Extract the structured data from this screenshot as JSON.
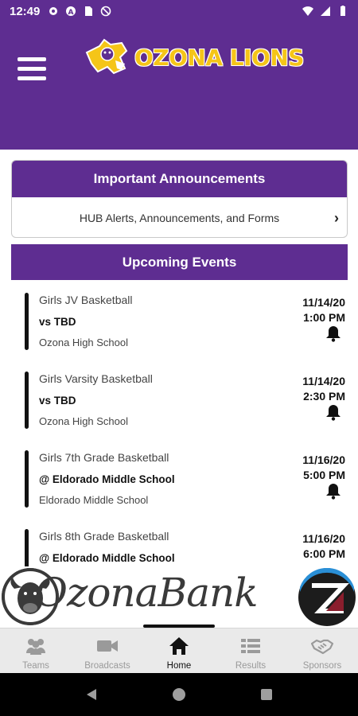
{
  "status_bar": {
    "time": "12:49",
    "left_icons": [
      "gear-icon",
      "a-icon",
      "sd-card-icon",
      "no-tracking-icon"
    ],
    "right_icons": [
      "wifi-icon",
      "signal-icon",
      "battery-icon"
    ]
  },
  "header": {
    "menu_icon": "hamburger-menu-icon",
    "logo_text": "OZONA LIONS",
    "logo_color": "#f5c518",
    "brand_color": "#5e2d91"
  },
  "announcements": {
    "title": "Important Announcements",
    "link_label": "HUB Alerts, Announcements, and Forms"
  },
  "events": {
    "title": "Upcoming Events",
    "items": [
      {
        "name": "Girls JV Basketball",
        "opponent": "vs TBD",
        "location": "Ozona High School",
        "date": "11/14/20",
        "time": "1:00 PM"
      },
      {
        "name": "Girls Varsity Basketball",
        "opponent": "vs TBD",
        "location": "Ozona High School",
        "date": "11/14/20",
        "time": "2:30 PM"
      },
      {
        "name": "Girls 7th Grade Basketball",
        "opponent": "@ Eldorado Middle School",
        "location": "Eldorado Middle School",
        "date": "11/16/20",
        "time": "5:00 PM"
      },
      {
        "name": "Girls 8th Grade Basketball",
        "opponent": "@ Eldorado Middle School",
        "location": "",
        "date": "11/16/20",
        "time": "6:00 PM"
      }
    ]
  },
  "sponsor": {
    "name": "OzonaBank"
  },
  "tabs": [
    {
      "label": "Teams",
      "icon": "teams-icon",
      "active": false
    },
    {
      "label": "Broadcasts",
      "icon": "video-camera-icon",
      "active": false
    },
    {
      "label": "Home",
      "icon": "home-icon",
      "active": true
    },
    {
      "label": "Results",
      "icon": "list-icon",
      "active": false
    },
    {
      "label": "Sponsors",
      "icon": "handshake-icon",
      "active": false
    }
  ],
  "nav": [
    "back-icon",
    "home-circle-icon",
    "recents-icon"
  ]
}
